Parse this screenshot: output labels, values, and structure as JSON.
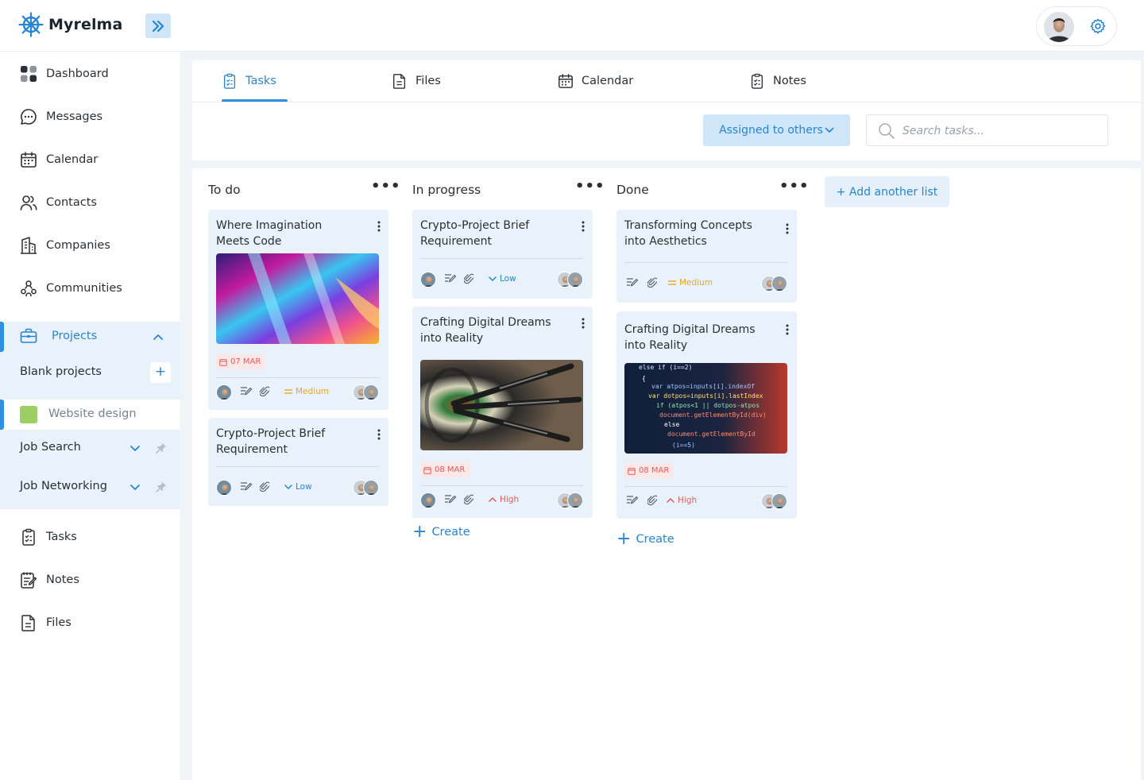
{
  "app": {
    "name": "Myrelma"
  },
  "sidebar": {
    "items": [
      {
        "label": "Dashboard",
        "icon": "dashboard-icon"
      },
      {
        "label": "Messages",
        "icon": "chat-icon"
      },
      {
        "label": "Calendar",
        "icon": "calendar-icon"
      },
      {
        "label": "Contacts",
        "icon": "contacts-icon"
      },
      {
        "label": "Companies",
        "icon": "building-icon"
      },
      {
        "label": "Communities",
        "icon": "community-icon"
      }
    ],
    "projects": {
      "label": "Projects",
      "blank_label": "Blank projects",
      "add_label": "+",
      "selected_project": "Website design",
      "selected_color": "#9bce63",
      "groups": [
        {
          "label": "Job Search"
        },
        {
          "label": "Job Networking"
        }
      ]
    },
    "bottom_items": [
      {
        "label": "Tasks",
        "icon": "tasks-icon"
      },
      {
        "label": "Notes",
        "icon": "notes-icon"
      },
      {
        "label": "Files",
        "icon": "file-icon"
      }
    ]
  },
  "tabs": [
    {
      "label": "Tasks",
      "icon": "tasks-icon",
      "active": true
    },
    {
      "label": "Files",
      "icon": "file-icon",
      "active": false
    },
    {
      "label": "Calendar",
      "icon": "calendar-icon",
      "active": false
    },
    {
      "label": "Notes",
      "icon": "notes-icon",
      "active": false
    }
  ],
  "filter": {
    "label": "Assigned to others"
  },
  "search": {
    "placeholder": "Search tasks..."
  },
  "colors": {
    "accent": "#2685d5",
    "card_bg": "#e9f1fa",
    "medium": "#e9a92b",
    "low": "#2685d5",
    "high": "#e45a5a"
  },
  "board": {
    "add_list_label": "+ Add another list",
    "create_label": "Create",
    "columns": [
      {
        "title": "To do",
        "cards": [
          {
            "title": "Where Imagination Meets Code",
            "image": "abstract-gradient",
            "date": "07 MAR",
            "priority": "Medium"
          },
          {
            "title": "Crypto-Project Brief Requirement",
            "priority": "Low"
          }
        ]
      },
      {
        "title": "In progress",
        "cards": [
          {
            "title": "Crypto-Project Brief Requirement",
            "priority": "Low"
          },
          {
            "title": "Crafting Digital Dreams into Reality",
            "image": "darts-target",
            "date": "08 MAR",
            "priority": "High"
          }
        ]
      },
      {
        "title": "Done",
        "cards": [
          {
            "title": "Transforming Concepts into Aesthetics",
            "priority": "Medium"
          },
          {
            "title": "Crafting Digital Dreams into Reality",
            "image": "code-screen",
            "date": "08 MAR",
            "priority": "High"
          }
        ]
      }
    ]
  }
}
